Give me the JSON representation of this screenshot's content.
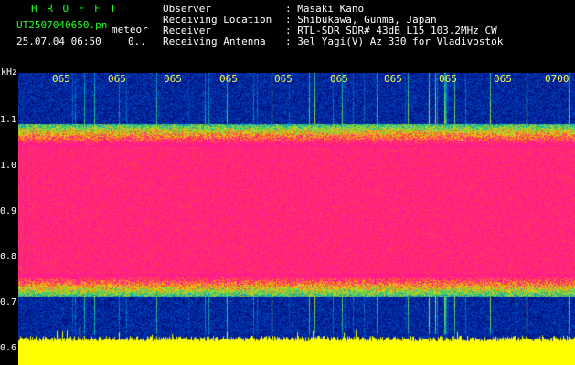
{
  "brand": "H R O F F T",
  "file_name": "UT2507040650.pn",
  "mode": "meteor",
  "datetime": "25.07.04 06:50",
  "count": "0..",
  "info": [
    {
      "label": "Observer",
      "value": ": Masaki Kano"
    },
    {
      "label": "Receiving Location",
      "value": ": Shibukawa, Gunma, Japan"
    },
    {
      "label": "Receiver",
      "value": ": RTL-SDR SDR# 43dB L15 103.2MHz CW"
    },
    {
      "label": "Receiving Antenna",
      "value": ": 3el Yagi(V) Az 330 for Vladivostok"
    }
  ],
  "axis": {
    "unit": "kHz",
    "y_ticks": [
      "1.1",
      "1.0",
      "0.9",
      "0.8",
      "0.7",
      "0.6"
    ],
    "x_ticks": [
      "065",
      "065",
      "065",
      "065",
      "065",
      "065",
      "065",
      "065",
      "065",
      "0700"
    ]
  },
  "colors": {
    "background": "#000000",
    "band_core": "#ff1a8c",
    "spectrum_baseline": "#ffff00",
    "header_brand": "#20ff20",
    "tick_labels": "#ffff40"
  }
}
